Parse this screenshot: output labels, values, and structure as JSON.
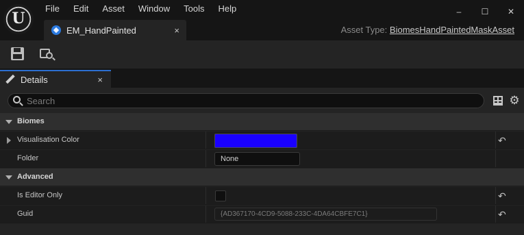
{
  "app": {
    "logo_letter": "U"
  },
  "menu": [
    "File",
    "Edit",
    "Asset",
    "Window",
    "Tools",
    "Help"
  ],
  "window_controls": {
    "minimize": "–",
    "maximize": "☐",
    "close": "✕"
  },
  "document_tab": {
    "label": "EM_HandPainted",
    "close": "×"
  },
  "asset_type": {
    "prefix": "Asset Type:",
    "value": "BiomesHandPaintedMaskAsset"
  },
  "toolbar": {
    "save_icon": "save-icon",
    "browse_icon": "browse-to-asset-icon"
  },
  "details_tab": {
    "label": "Details",
    "close": "×"
  },
  "search": {
    "placeholder": "Search",
    "value": ""
  },
  "categories": {
    "biomes": "Biomes",
    "advanced": "Advanced"
  },
  "properties": {
    "visualisation_color": {
      "label": "Visualisation Color",
      "value": "#1a00ff"
    },
    "folder": {
      "label": "Folder",
      "value": "None"
    },
    "is_editor_only": {
      "label": "Is Editor Only",
      "checked": false
    },
    "guid": {
      "label": "Guid",
      "value": "{AD367170-4CD9-5088-233C-4DA64CBFE7C1}"
    }
  },
  "reset_glyph": "↶"
}
